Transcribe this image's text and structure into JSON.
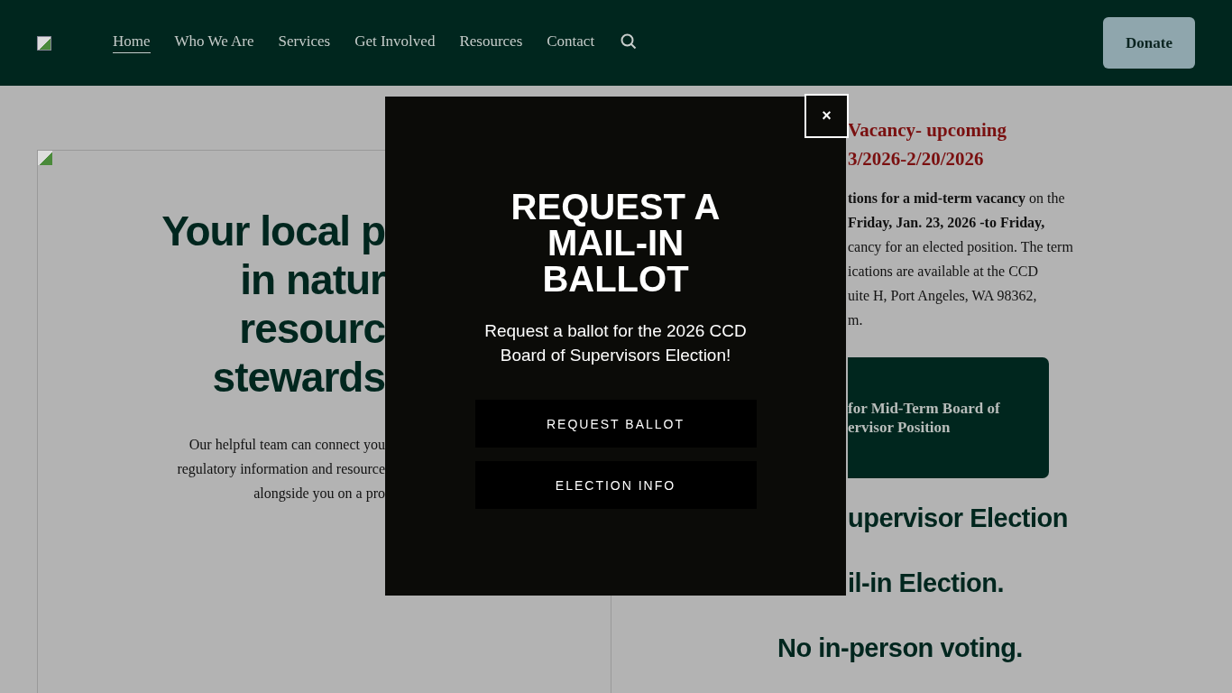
{
  "header": {
    "nav": [
      {
        "label": "Home",
        "selected": true
      },
      {
        "label": "Who We Are",
        "selected": false
      },
      {
        "label": "Services",
        "selected": false
      },
      {
        "label": "Get Involved",
        "selected": false
      },
      {
        "label": "Resources",
        "selected": false
      },
      {
        "label": "Contact",
        "selected": false
      }
    ],
    "donate": "Donate"
  },
  "hero": {
    "heading_lines": [
      "Your local p",
      "in natur",
      "resourc",
      "stewards"
    ],
    "text_lines": [
      "Our helpful team can connect you",
      "regulatory information and resource",
      "alongside you on a pro"
    ]
  },
  "notice": {
    "title_lines": [
      "Vacancy- upcoming",
      "3/2026-2/20/2026"
    ],
    "text_lines": [
      "**tions for a mid-term vacancy** on the",
      "**Friday, Jan. 23, 2026 -to Friday,**",
      "cancy for an elected position. The term",
      "ications are available at the CCD",
      "uite H, Port Angeles, WA 98362,",
      "m."
    ],
    "button_lines": [
      "for Mid-Term Board of",
      "ervisor Position"
    ],
    "election_lines": [
      "upervisor Election",
      "il-in Election."
    ],
    "voting_line": "No in-person voting."
  },
  "modal": {
    "close": "×",
    "title": "REQUEST A MAIL-IN BALLOT",
    "text": "Request a ballot for the 2026 CCD Board of Supervisors Election!",
    "buttons": [
      "REQUEST BALLOT",
      "ELECTION INFO"
    ]
  }
}
